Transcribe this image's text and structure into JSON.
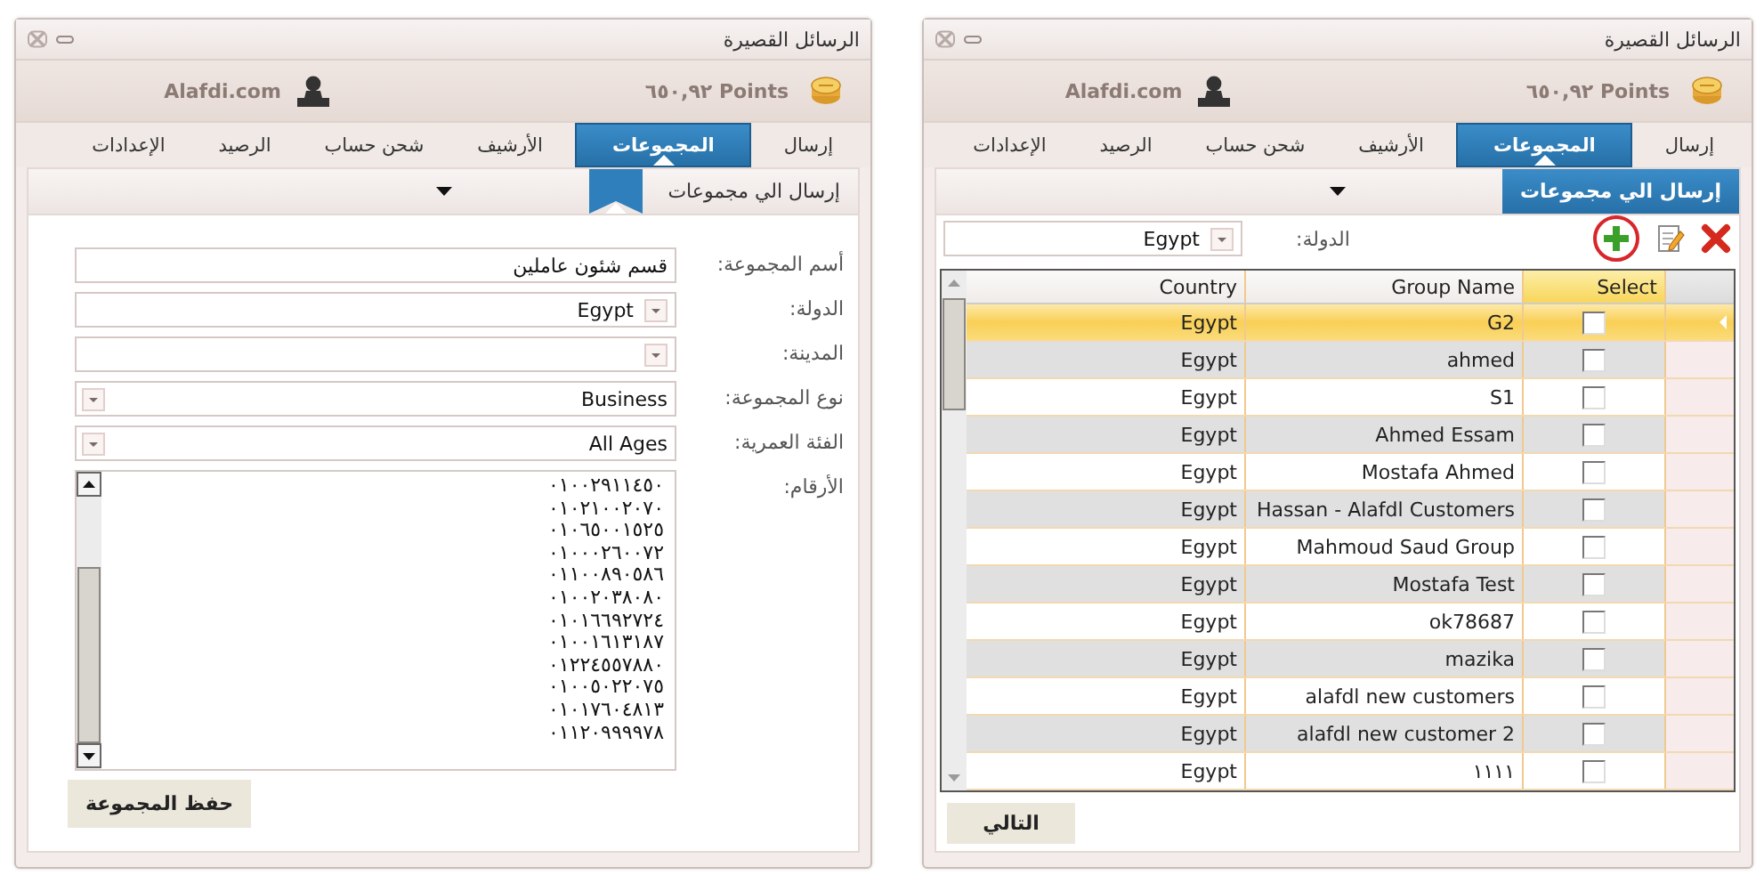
{
  "windows": [
    {
      "kind": "group-list",
      "title": "الرسائل القصيرة",
      "points": "Points ٦٥٠,٩٢",
      "user": "Alafdi.com",
      "tabs": [
        {
          "label": "إرسال",
          "selected": false
        },
        {
          "label": "المجموعات",
          "selected": true
        },
        {
          "label": "الأرشيف",
          "selected": false
        },
        {
          "label": "شحن حساب",
          "selected": false
        },
        {
          "label": "الرصيد",
          "selected": false
        },
        {
          "label": "الإعدادات",
          "selected": false
        }
      ],
      "subtab": {
        "label": "إرسال الي مجموعات",
        "selected": true
      },
      "toolbar": [
        {
          "kind": "delete",
          "circled": false
        },
        {
          "kind": "edit",
          "circled": false
        },
        {
          "kind": "add",
          "circled": true
        }
      ],
      "filter": {
        "label": "الدولة:",
        "value": "Egypt"
      },
      "columns": [
        "Select",
        "Group Name",
        "Country"
      ],
      "rows": [
        {
          "group_name": "G2",
          "country": "Egypt",
          "checked": false,
          "selected": true
        },
        {
          "group_name": "ahmed",
          "country": "Egypt",
          "checked": false,
          "selected": false
        },
        {
          "group_name": "S1",
          "country": "Egypt",
          "checked": false,
          "selected": false
        },
        {
          "group_name": "Ahmed Essam",
          "country": "Egypt",
          "checked": false,
          "selected": false
        },
        {
          "group_name": "Mostafa Ahmed",
          "country": "Egypt",
          "checked": false,
          "selected": false
        },
        {
          "group_name": "Hassan - Alafdl Customers",
          "country": "Egypt",
          "checked": false,
          "selected": false
        },
        {
          "group_name": "Mahmoud Saud Group",
          "country": "Egypt",
          "checked": false,
          "selected": false
        },
        {
          "group_name": "Mostafa Test",
          "country": "Egypt",
          "checked": false,
          "selected": false
        },
        {
          "group_name": "ok78687",
          "country": "Egypt",
          "checked": false,
          "selected": false
        },
        {
          "group_name": "mazika",
          "country": "Egypt",
          "checked": false,
          "selected": false
        },
        {
          "group_name": "alafdl new customers",
          "country": "Egypt",
          "checked": false,
          "selected": false
        },
        {
          "group_name": "alafdl new customer 2",
          "country": "Egypt",
          "checked": false,
          "selected": false
        },
        {
          "group_name": "١١١١",
          "country": "Egypt",
          "checked": false,
          "selected": false
        }
      ],
      "button": "التالي"
    },
    {
      "kind": "group-form",
      "title": "الرسائل القصيرة",
      "points": "Points ٦٥٠,٩٢",
      "user": "Alafdi.com",
      "tabs": [
        {
          "label": "إرسال",
          "selected": false
        },
        {
          "label": "المجموعات",
          "selected": true
        },
        {
          "label": "الأرشيف",
          "selected": false
        },
        {
          "label": "شحن حساب",
          "selected": false
        },
        {
          "label": "الرصيد",
          "selected": false
        },
        {
          "label": "الإعدادات",
          "selected": false
        }
      ],
      "subtab": {
        "label": "إرسال الي مجموعات",
        "selected": false
      },
      "fields": [
        {
          "kind": "text",
          "label": "أسم المجموعة:",
          "value": "قسم شئون عاملين"
        },
        {
          "kind": "combo",
          "label": "الدولة:",
          "value": "Egypt"
        },
        {
          "kind": "dropdown",
          "label": "المدينة:"
        },
        {
          "kind": "dropdown",
          "label": "نوع المجموعة:",
          "value": "Business"
        },
        {
          "kind": "dropdown",
          "label": "الفئة العمرية:",
          "value": "All Ages"
        },
        {
          "kind": "textarea",
          "label": "الأرقام:",
          "lines": [
            "٠١٠٠٢٩١١٤٥٠",
            "٠١٠٢١٠٠٢٠٧٠",
            "٠١٠٦٥٠٠١٥٢٥",
            "٠١٠٠٠٢٦٠٠٧٢",
            "٠١١٠٠٨٩٠٥٨٦",
            "٠١٠٠٢٠٣٨٠٨٠",
            "٠١٠١٦٦٩٢٧٢٤",
            "٠١٠٠١٦١٣١٨٧",
            "٠١٢٢٤٥٥٧٨٨٠",
            "٠١٠٠٥٠٢٢٠٧٥",
            "٠١٠١٧٦٠٤٨١٣",
            "٠١١٢٠٩٩٩٩٧٨"
          ]
        }
      ],
      "button": "حفظ المجموعة"
    }
  ]
}
